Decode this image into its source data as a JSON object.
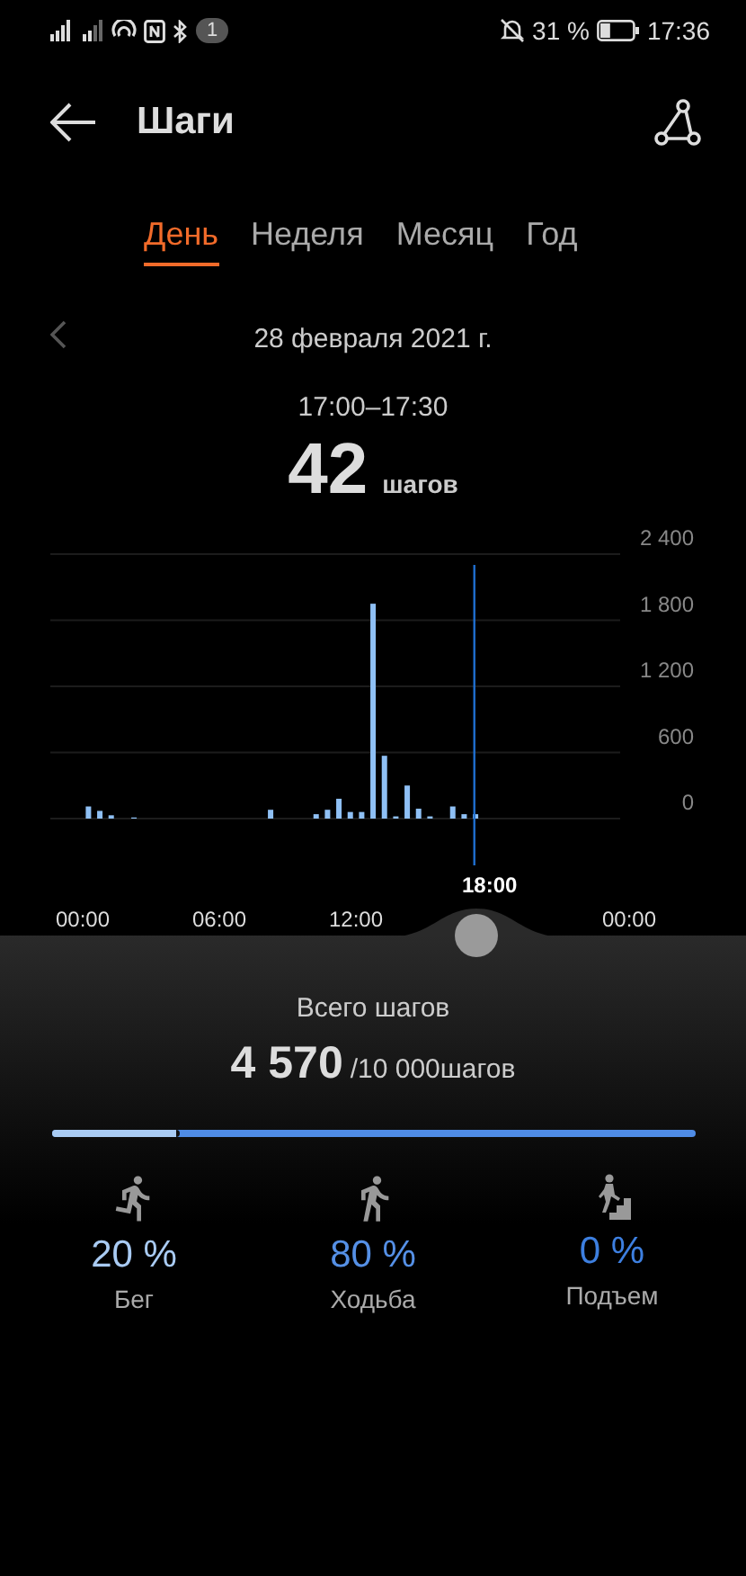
{
  "status_bar": {
    "badge": "1",
    "battery": "31 %",
    "time": "17:36"
  },
  "header": {
    "title": "Шаги"
  },
  "tabs": [
    {
      "label": "День",
      "selected": true
    },
    {
      "label": "Неделя",
      "selected": false
    },
    {
      "label": "Месяц",
      "selected": false
    },
    {
      "label": "Год",
      "selected": false
    }
  ],
  "date_nav": {
    "date": "28 февраля 2021 г."
  },
  "selection": {
    "range": "17:00–17:30",
    "value": "42",
    "unit": "шагов"
  },
  "chart": {
    "chart_data": {
      "type": "bar",
      "x": [
        0,
        0.5,
        1,
        2,
        8,
        10,
        10.5,
        11,
        11.5,
        12,
        12.5,
        13,
        13.5,
        14,
        14.5,
        15,
        16,
        16.5,
        17
      ],
      "series": [
        {
          "color": "#8fc0f5",
          "values": [
            110,
            70,
            30,
            10,
            80,
            40,
            80,
            180,
            60,
            60,
            1950,
            570,
            20,
            300,
            90,
            20,
            110,
            40,
            40
          ]
        }
      ],
      "xlim": [
        0,
        24
      ],
      "grid": true,
      "ref_lines": [
        {
          "axis": "x",
          "value": 17.2
        }
      ],
      "ylim": [
        0,
        2400
      ],
      "yticks": [
        {
          "value": 0,
          "label": "0"
        },
        {
          "value": 600,
          "label": "600"
        },
        {
          "value": 1200,
          "label": "1 200"
        },
        {
          "value": 1800,
          "label": "1 800"
        },
        {
          "value": 2400,
          "label": "2 400"
        }
      ],
      "xticks": [
        {
          "value": 0,
          "label": "00:00"
        },
        {
          "value": 6,
          "label": "06:00"
        },
        {
          "value": 12,
          "label": "12:00"
        },
        {
          "value": 24,
          "label": "00:00"
        }
      ]
    },
    "marker_label": "18:00"
  },
  "summary": {
    "label": "Всего шагов",
    "value": "4 570",
    "goal": "/10 000шагов"
  },
  "share_bar": {
    "level": 0.2
  },
  "activities": [
    {
      "kind": "run",
      "percent": "20 %",
      "label": "Бег",
      "color": "#a9cbf3"
    },
    {
      "kind": "walk",
      "percent": "80 %",
      "label": "Ходьба",
      "color": "#5590e6"
    },
    {
      "kind": "climb",
      "percent": "0 %",
      "label": "Подъем",
      "color": "#3d7fe0"
    }
  ]
}
